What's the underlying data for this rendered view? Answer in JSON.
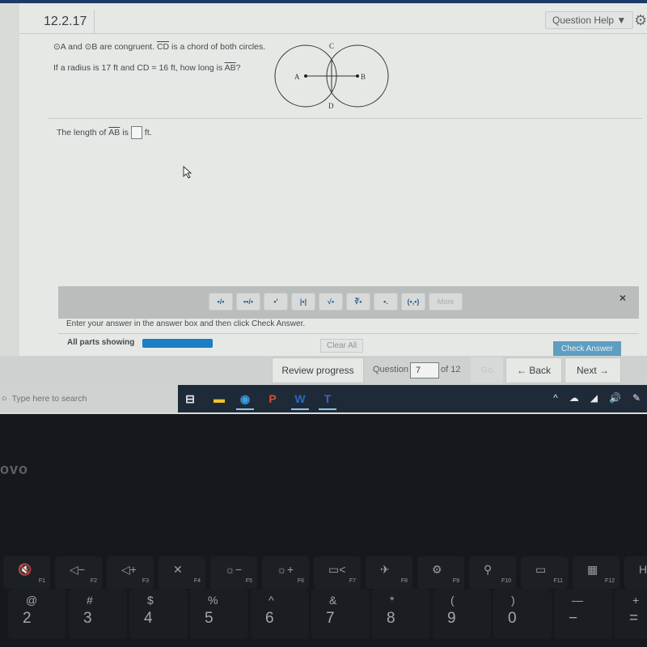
{
  "header": {
    "section_id": "12.2.17",
    "help_label": "Question Help",
    "help_caret": "▼",
    "gear_glyph": "⚙"
  },
  "question": {
    "line1_parts": [
      "⊙A and ⊙B are congruent. ",
      "CD",
      " is a chord of both circles."
    ],
    "line2_parts": [
      "If a radius is 17 ft and CD = 16 ft, how long is ",
      "AB",
      "?"
    ],
    "diagram": {
      "points": [
        "A",
        "B",
        "C",
        "D"
      ],
      "radius_ft": 17,
      "chord_ft": 16
    }
  },
  "answer": {
    "prefix": "The length of ",
    "segment": "AB",
    "mid": " is",
    "value": "",
    "unit": "ft."
  },
  "toolbar": {
    "tools": [
      {
        "name": "fraction",
        "glyph": "▪/▪"
      },
      {
        "name": "mixed-number",
        "glyph": "▪▪/▪"
      },
      {
        "name": "exponent",
        "glyph": "▪'"
      },
      {
        "name": "absolute-value",
        "glyph": "|▪|"
      },
      {
        "name": "square-root",
        "glyph": "√▪"
      },
      {
        "name": "nth-root",
        "glyph": "∛▪"
      },
      {
        "name": "subscript",
        "glyph": "▪."
      },
      {
        "name": "ordered-pair",
        "glyph": "(▪,▪)"
      }
    ],
    "more_label": "More",
    "close_glyph": "×"
  },
  "footer": {
    "instruction": "Enter your answer in the answer box and then click Check Answer.",
    "parts_label": "All parts showing",
    "progress_fraction": 1.0,
    "clear_all": "Clear All",
    "check_answer": "Check Answer"
  },
  "nav": {
    "review": "Review progress",
    "question_label": "Question",
    "question_number": "7",
    "of_total": "of 12",
    "go": "Go",
    "back": "← Back",
    "next": "Next →"
  },
  "taskbar": {
    "search_icon": "○",
    "search_placeholder": "Type here to search",
    "apps": [
      {
        "name": "task-view",
        "glyph": "⊟",
        "color": "#e6e8ea",
        "active": false
      },
      {
        "name": "file-explorer",
        "glyph": "▬",
        "color": "#f2c230",
        "active": false
      },
      {
        "name": "chrome",
        "glyph": "◉",
        "color": "#3aa0e0",
        "active": true
      },
      {
        "name": "powerpoint",
        "glyph": "P",
        "color": "#d9502e",
        "active": false
      },
      {
        "name": "word",
        "glyph": "W",
        "color": "#2b66c2",
        "active": true
      },
      {
        "name": "teams",
        "glyph": "T",
        "color": "#5059c9",
        "active": true
      }
    ],
    "tray": [
      "^",
      "☁",
      "◢",
      "🔊",
      "✎"
    ]
  },
  "laptop": {
    "brand": "ovo",
    "fkeys": [
      {
        "label": "F1",
        "glyph": "🔇"
      },
      {
        "label": "F2",
        "glyph": "◁−"
      },
      {
        "label": "F3",
        "glyph": "◁+"
      },
      {
        "label": "F4",
        "glyph": "✕"
      },
      {
        "label": "F5",
        "glyph": "☼−"
      },
      {
        "label": "F6",
        "glyph": "☼+"
      },
      {
        "label": "F7",
        "glyph": "▭<"
      },
      {
        "label": "F8",
        "glyph": "✈"
      },
      {
        "label": "F9",
        "glyph": "⚙"
      },
      {
        "label": "F10",
        "glyph": "⚲"
      },
      {
        "label": "F11",
        "glyph": "▭"
      },
      {
        "label": "F12",
        "glyph": "▦"
      },
      {
        "label": "",
        "glyph": "Home"
      }
    ],
    "numkeys": [
      {
        "top": "@",
        "bot": "2"
      },
      {
        "top": "#",
        "bot": "3"
      },
      {
        "top": "$",
        "bot": "4"
      },
      {
        "top": "%",
        "bot": "5"
      },
      {
        "top": "^",
        "bot": "6"
      },
      {
        "top": "&",
        "bot": "7"
      },
      {
        "top": "*",
        "bot": "8"
      },
      {
        "top": "(",
        "bot": "9"
      },
      {
        "top": ")",
        "bot": "0"
      },
      {
        "top": "—",
        "bot": "−"
      },
      {
        "top": "+",
        "bot": "="
      }
    ]
  }
}
